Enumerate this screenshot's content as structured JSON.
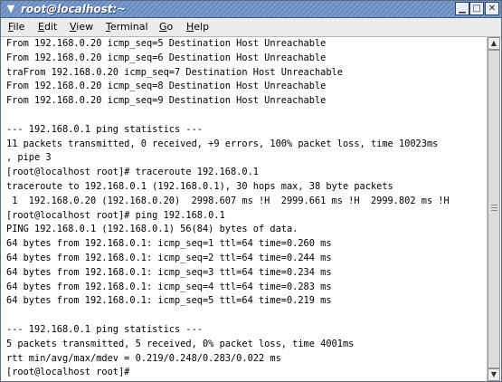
{
  "window": {
    "title": "root@localhost:~"
  },
  "menu": [
    {
      "mnemonic": "F",
      "rest": "ile"
    },
    {
      "mnemonic": "E",
      "rest": "dit"
    },
    {
      "mnemonic": "V",
      "rest": "iew"
    },
    {
      "mnemonic": "T",
      "rest": "erminal"
    },
    {
      "mnemonic": "G",
      "rest": "o"
    },
    {
      "mnemonic": "H",
      "rest": "elp"
    }
  ],
  "terminal": {
    "lines": [
      "From 192.168.0.20 icmp_seq=5 Destination Host Unreachable",
      "From 192.168.0.20 icmp_seq=6 Destination Host Unreachable",
      "traFrom 192.168.0.20 icmp_seq=7 Destination Host Unreachable",
      "From 192.168.0.20 icmp_seq=8 Destination Host Unreachable",
      "From 192.168.0.20 icmp_seq=9 Destination Host Unreachable",
      "",
      "--- 192.168.0.1 ping statistics ---",
      "11 packets transmitted, 0 received, +9 errors, 100% packet loss, time 10023ms",
      ", pipe 3",
      "[root@localhost root]# traceroute 192.168.0.1",
      "traceroute to 192.168.0.1 (192.168.0.1), 30 hops max, 38 byte packets",
      " 1  192.168.0.20 (192.168.0.20)  2998.607 ms !H  2999.661 ms !H  2999.802 ms !H",
      "[root@localhost root]# ping 192.168.0.1",
      "PING 192.168.0.1 (192.168.0.1) 56(84) bytes of data.",
      "64 bytes from 192.168.0.1: icmp_seq=1 ttl=64 time=0.260 ms",
      "64 bytes from 192.168.0.1: icmp_seq=2 ttl=64 time=0.244 ms",
      "64 bytes from 192.168.0.1: icmp_seq=3 ttl=64 time=0.234 ms",
      "64 bytes from 192.168.0.1: icmp_seq=4 ttl=64 time=0.283 ms",
      "64 bytes from 192.168.0.1: icmp_seq=5 ttl=64 time=0.219 ms",
      "",
      "--- 192.168.0.1 ping statistics ---",
      "5 packets transmitted, 5 received, 0% packet loss, time 4001ms",
      "rtt min/avg/max/mdev = 0.219/0.248/0.283/0.022 ms",
      "[root@localhost root]# "
    ]
  },
  "scrollbar": {
    "position": 1.0
  },
  "icons": {
    "window_menu": "chevron-down-icon",
    "minimize": "minimize-icon",
    "maximize": "maximize-icon",
    "close": "close-icon",
    "scroll_up": "arrow-up-icon",
    "scroll_down": "arrow-down-icon"
  },
  "colors": {
    "titlebar": "#6a8bc0",
    "menubar": "#ececec",
    "terminal_bg": "#ffffff",
    "terminal_fg": "#000000"
  }
}
